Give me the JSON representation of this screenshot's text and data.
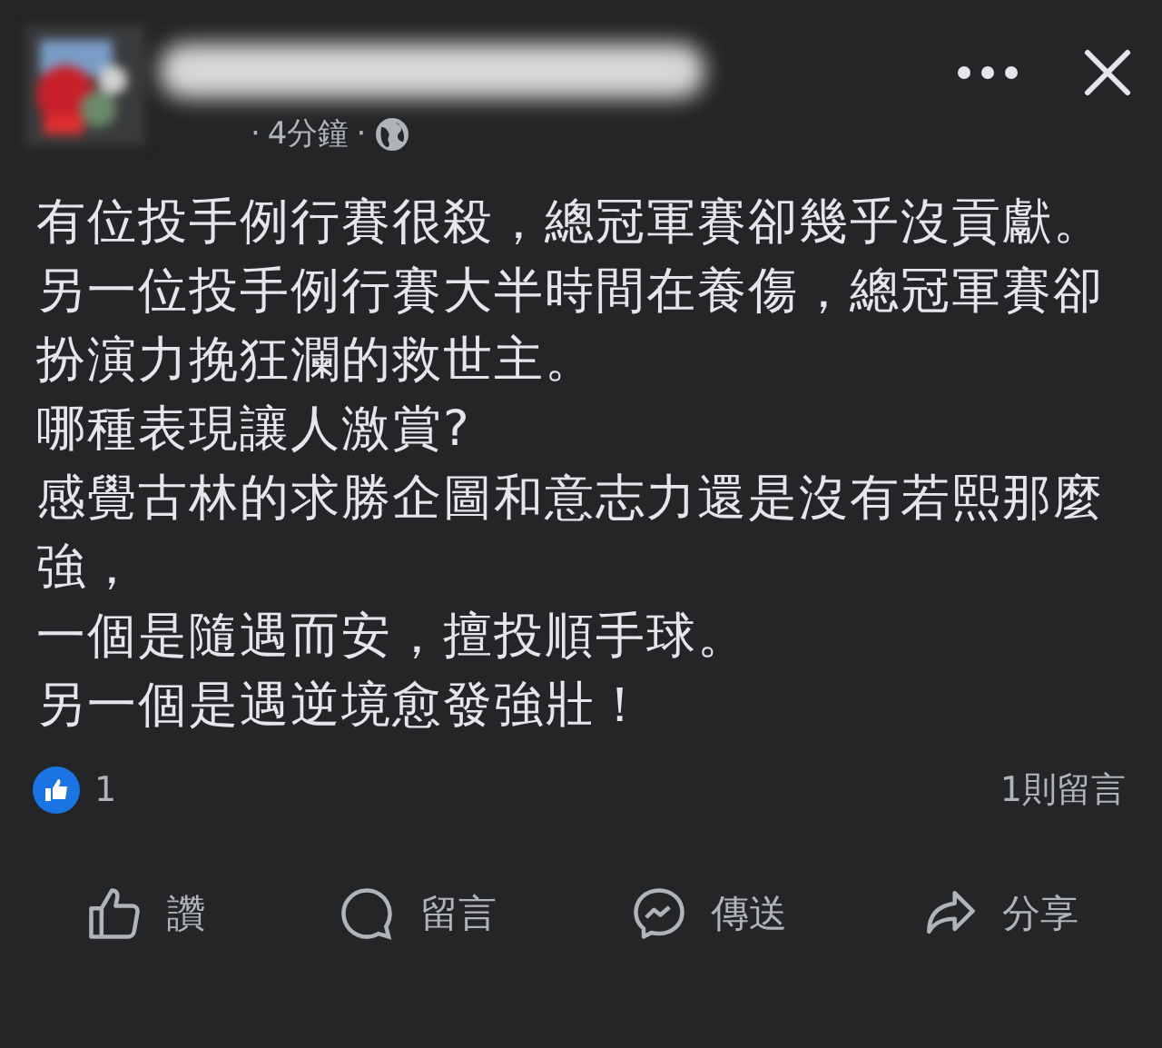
{
  "post": {
    "time": "4分鐘",
    "separator": "·",
    "paragraphs": [
      "有位投手例行賽很殺，總冠軍賽卻幾乎沒貢獻。",
      "另一位投手例行賽大半時間在養傷，總冠軍賽卻扮演力挽狂瀾的救世主。",
      "哪種表現讓人激賞?",
      "感覺古林的求勝企圖和意志力還是沒有若熙那麼強，",
      "一個是隨遇而安，擅投順手球。",
      "另一個是遇逆境愈發強壯！"
    ],
    "reaction_count": "1",
    "comment_count": "1則留言"
  },
  "actions": [
    {
      "kind": "like",
      "label": "讚"
    },
    {
      "kind": "comment",
      "label": "留言"
    },
    {
      "kind": "send",
      "label": "傳送"
    },
    {
      "kind": "share",
      "label": "分享"
    }
  ]
}
